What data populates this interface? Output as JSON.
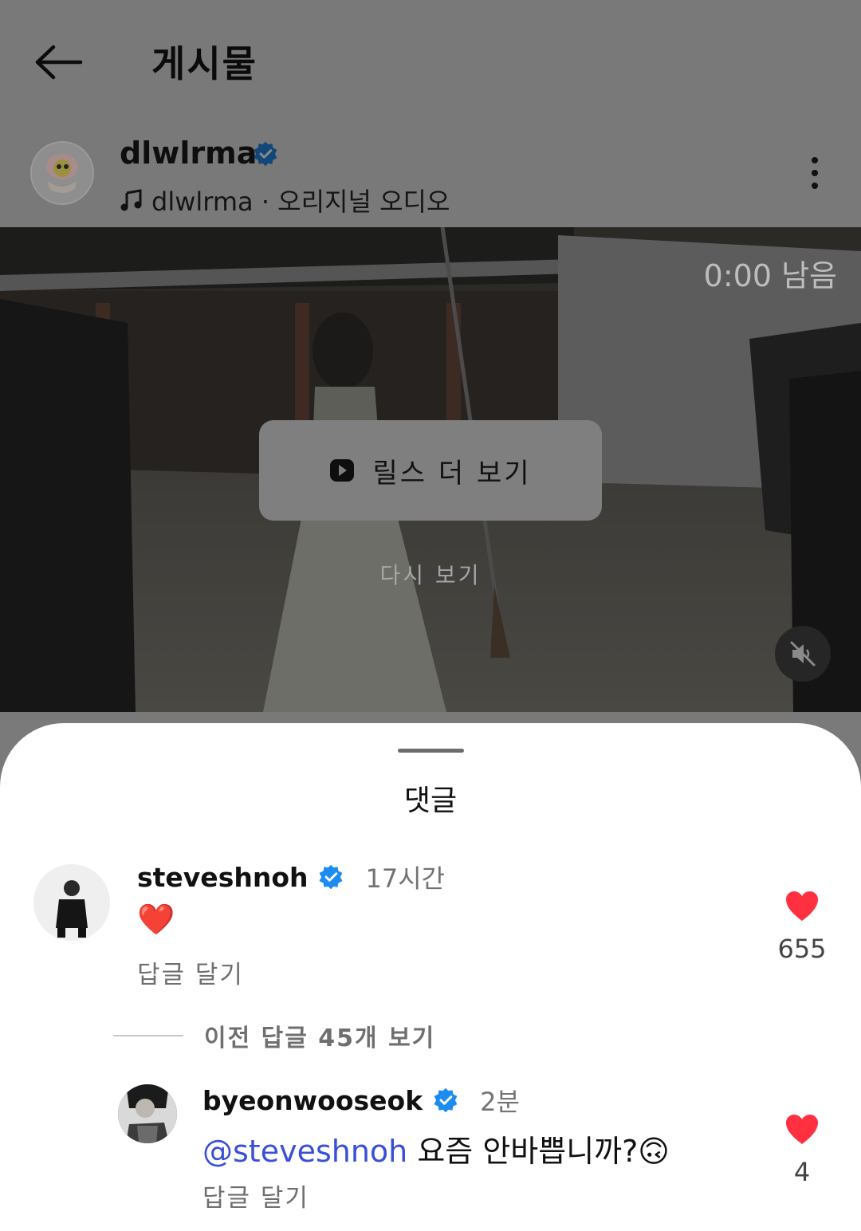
{
  "header": {
    "title": "게시물",
    "back_icon": "arrow-left-icon"
  },
  "post": {
    "username": "dlwlrma",
    "verified": true,
    "audio_text": "dlwlrma · 오리지널 오디오",
    "audio_icon": "music-note-icon",
    "more_icon": "vertical-dots-icon"
  },
  "video": {
    "time_left": "0:00 남음",
    "more_reels_label": "릴스 더 보기",
    "replay_label": "다시 보기",
    "mute_icon": "speaker-muted-icon"
  },
  "comments_sheet": {
    "title": "댓글",
    "comments": [
      {
        "username": "steveshnoh",
        "verified": true,
        "time": "17시간",
        "text": "❤️",
        "reply_label": "답글 달기",
        "likes": "655"
      }
    ],
    "view_previous_replies": "이전 답글 45개 보기",
    "replies": [
      {
        "username": "byeonwooseok",
        "verified": true,
        "time": "2분",
        "mention": "@steveshnoh",
        "text": " 요즘 안바쁩니까?🙃",
        "reply_label": "답글 달기",
        "likes": "4"
      }
    ]
  },
  "colors": {
    "verified_blue": "#1d8cf0",
    "like_red": "#ff3040",
    "mention_blue": "#3a4fd8",
    "dim_overlay": "#797979"
  }
}
